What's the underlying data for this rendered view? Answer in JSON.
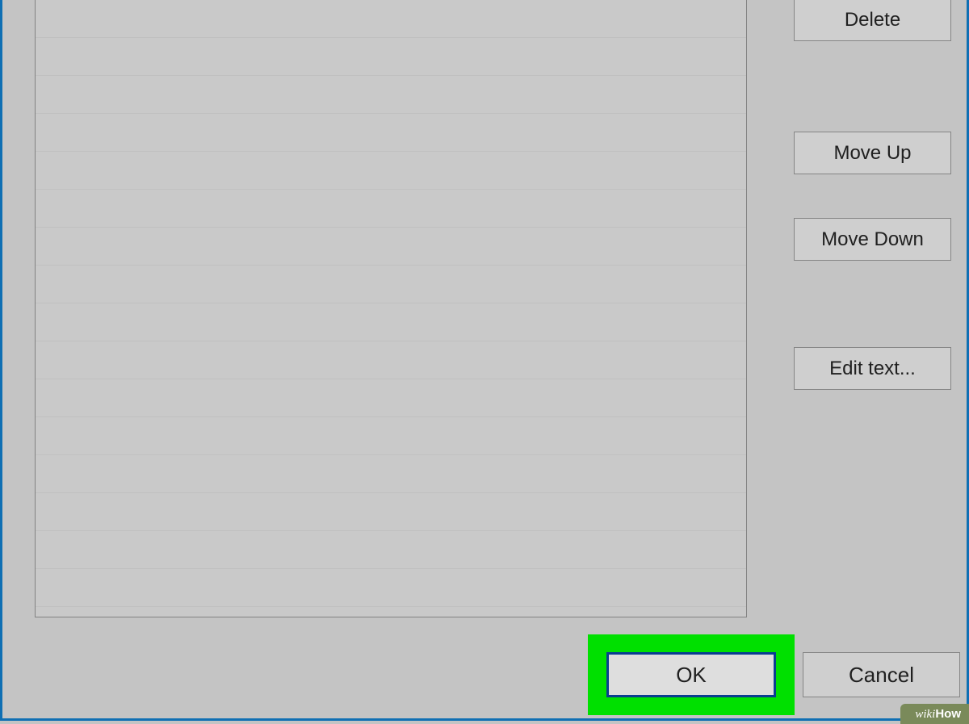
{
  "side_buttons": {
    "delete": "Delete",
    "move_up": "Move Up",
    "move_down": "Move Down",
    "edit_text": "Edit text..."
  },
  "footer": {
    "ok": "OK",
    "cancel": "Cancel"
  },
  "watermark": {
    "prefix": "wiki",
    "suffix": "How"
  }
}
